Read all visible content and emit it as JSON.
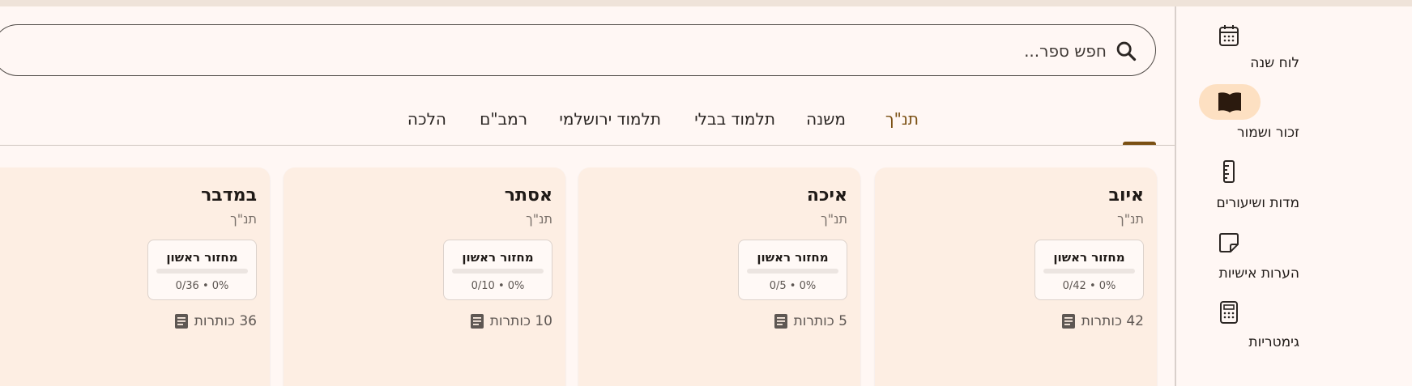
{
  "rail": {
    "items": [
      {
        "label": "לוח שנה",
        "icon": "calendar-icon",
        "active": false
      },
      {
        "label": "זכור ושמור",
        "icon": "book-icon",
        "active": true
      },
      {
        "label": "מדות ושיעורים",
        "icon": "ruler-icon",
        "active": false
      },
      {
        "label": "הערות אישיות",
        "icon": "note-icon",
        "active": false
      },
      {
        "label": "גימטריות",
        "icon": "calculator-icon",
        "active": false
      }
    ]
  },
  "search": {
    "placeholder": "חפש ספר..."
  },
  "tabs": [
    {
      "label": "תנ\"ך",
      "active": true
    },
    {
      "label": "משנה",
      "active": false
    },
    {
      "label": "תלמוד בבלי",
      "active": false
    },
    {
      "label": "תלמוד ירושלמי",
      "active": false
    },
    {
      "label": "רמב\"ם",
      "active": false
    },
    {
      "label": "הלכה",
      "active": false
    }
  ],
  "cards": [
    {
      "title": "איוב",
      "subtitle": "תנ\"ך",
      "cycle_label": "מחזור ראשון",
      "progress": 0,
      "stats": "0/42 • 0%",
      "count_text": "42 כותרות"
    },
    {
      "title": "איכה",
      "subtitle": "תנ\"ך",
      "cycle_label": "מחזור ראשון",
      "progress": 0,
      "stats": "0/5 • 0%",
      "count_text": "5 כותרות"
    },
    {
      "title": "אסתר",
      "subtitle": "תנ\"ך",
      "cycle_label": "מחזור ראשון",
      "progress": 0,
      "stats": "0/10 • 0%",
      "count_text": "10 כותרות"
    },
    {
      "title": "במדבר",
      "subtitle": "תנ\"ך",
      "cycle_label": "מחזור ראשון",
      "progress": 0,
      "stats": "0/36 • 0%",
      "count_text": "36 כותרות"
    }
  ],
  "colors": {
    "accent": "#7a4f12",
    "active_pill": "#fde0c2",
    "card_bg": "#fdeee3",
    "page_bg": "#fff7f4"
  }
}
